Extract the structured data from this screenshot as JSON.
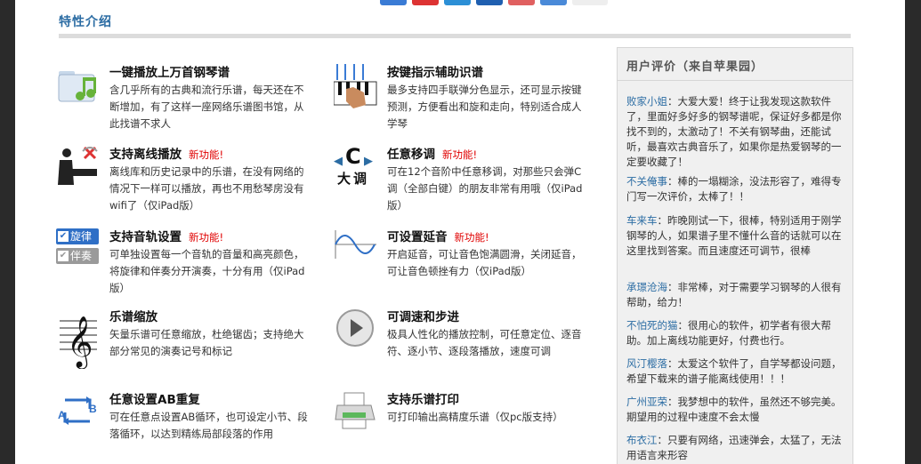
{
  "section_title": "特性介绍",
  "features": [
    {
      "title": "一键播放上万首钢琴谱",
      "new": "",
      "desc": "含几乎所有的古典和流行乐谱，每天还在不断增加，有了这样一座网络乐谱图书馆，从此找谱不求人"
    },
    {
      "title": "按键指示辅助识谱",
      "new": "",
      "desc": "最多支持四手联弹分色显示，还可显示按键预测，方便看出和旋和走向，特别适合成人学琴"
    },
    {
      "title": "支持离线播放",
      "new": "新功能!",
      "desc": "离线库和历史记录中的乐谱，在没有网络的情况下一样可以播放，再也不用愁琴房没有wifi了（仅iPad版）"
    },
    {
      "title": "任意移调",
      "new": "新功能!",
      "desc": "可在12个音阶中任意移调，对那些只会弹C调（全部白键）的朋友非常有用哦（仅iPad版）"
    },
    {
      "title": "支持音轨设置",
      "new": "新功能!",
      "desc": "可单独设置每一个音轨的音量和高亮颜色，将旋律和伴奏分开演奏，十分有用（仅iPad版）"
    },
    {
      "title": "可设置延音",
      "new": "新功能!",
      "desc": "开启延音，可让音色饱满圆滑，关闭延音，可让音色顿挫有力（仅iPad版）"
    },
    {
      "title": "乐谱缩放",
      "new": "",
      "desc": "矢量乐谱可任意缩放，杜绝锯齿；支持绝大部分常见的演奏记号和标记"
    },
    {
      "title": "可调速和步进",
      "new": "",
      "desc": "极具人性化的播放控制，可任意定位、逐音符、逐小节、逐段落播放，速度可调"
    },
    {
      "title": "任意设置AB重复",
      "new": "",
      "desc": "可在任意点设置AB循环，也可设定小节、段落循环，以达到精练局部段落的作用"
    },
    {
      "title": "支持乐谱打印",
      "new": "",
      "desc": "可打印输出高精度乐谱（仅pc版支持）"
    }
  ],
  "icons": {
    "track_melody": "旋律",
    "track_accomp": "伴奏",
    "transpose_label": "大调",
    "transpose_key": "C"
  },
  "reviews_title": "用户评价（来自苹果园）",
  "reviews": [
    {
      "name": "败家小姐",
      "text": "：大爱大爱！终于让我发现这款软件了，里面好多好多的钢琴谱呢，保证好多都是你找不到的，太激动了！不关有钢琴曲，还能试听，最喜欢古典音乐了，如果你是热爱钢琴的一定要收藏了！"
    },
    {
      "name": "不关俺事",
      "text": "：棒的一塌糊涂，没法形容了，难得专门写一次评价，太棒了！！"
    },
    {
      "name": "车来车",
      "text": "：昨晚刚试一下，很棒，特别适用于刚学钢琴的人，如果谱子里不懂什么音的话就可以在这里找到答案。而且速度还可调节，很棒"
    },
    {
      "name": "承璟沧海",
      "text": "：非常棒，对于需要学习钢琴的人很有帮助，给力！"
    },
    {
      "name": "不怕死的猫",
      "text": "：很用心的软件，初学者有很大帮助。加上离线功能更好，付费也行。"
    },
    {
      "name": "风汀樱落",
      "text": "：太爱这个软件了，自学琴都设问题，希望下载来的谱子能离线使用！！！"
    },
    {
      "name": "广州亚荣",
      "text": "：我梦想中的软件，虽然还不够完美。期望用的过程中速度不会太慢"
    },
    {
      "name": "布衣江",
      "text": "：只要有网络，迅速弹会，太猛了，无法用语言来形容"
    }
  ],
  "colors": {
    "accent": "#2b6ca3",
    "new": "#e00000"
  }
}
